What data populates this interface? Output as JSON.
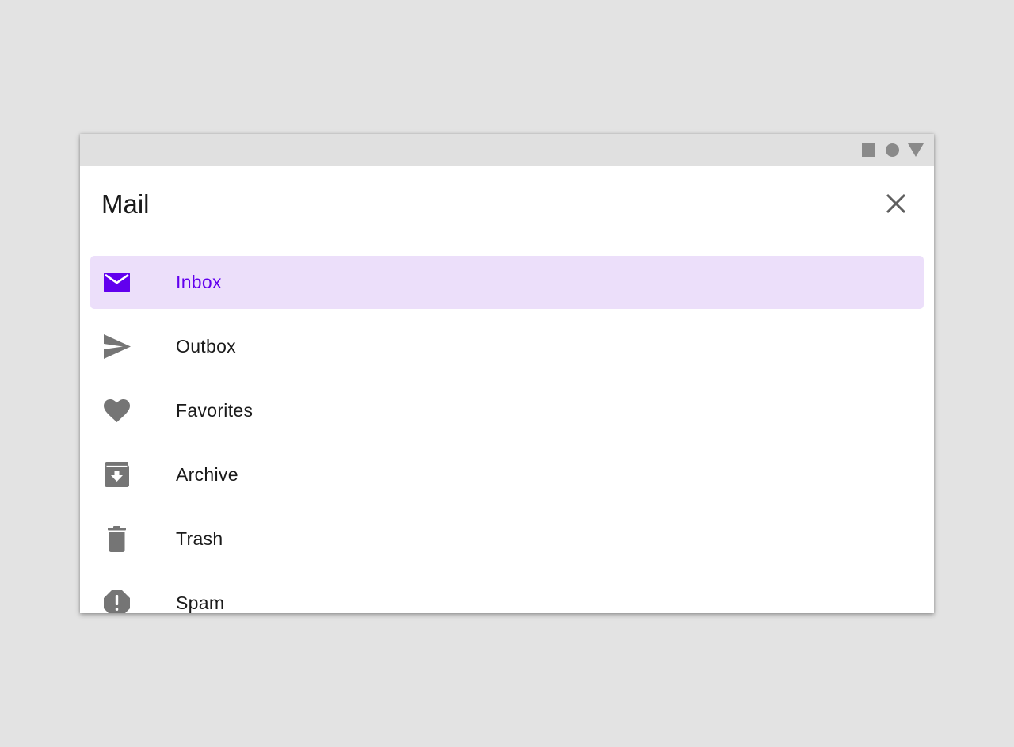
{
  "app": {
    "title": "Mail"
  },
  "colors": {
    "accent": "#6200ee",
    "active_background": "#ecdffa",
    "icon": "#757575",
    "statusbar": "#e0e0e0",
    "page_background": "#e3e3e3"
  },
  "statusbar": {
    "icons": [
      "square-icon",
      "circle-icon",
      "triangle-icon"
    ]
  },
  "header": {
    "close_icon": "close-icon"
  },
  "nav": {
    "items": [
      {
        "label": "Inbox",
        "icon": "mail-icon",
        "active": true
      },
      {
        "label": "Outbox",
        "icon": "send-icon",
        "active": false
      },
      {
        "label": "Favorites",
        "icon": "heart-icon",
        "active": false
      },
      {
        "label": "Archive",
        "icon": "archive-icon",
        "active": false
      },
      {
        "label": "Trash",
        "icon": "trash-icon",
        "active": false
      },
      {
        "label": "Spam",
        "icon": "report-icon",
        "active": false
      }
    ]
  }
}
